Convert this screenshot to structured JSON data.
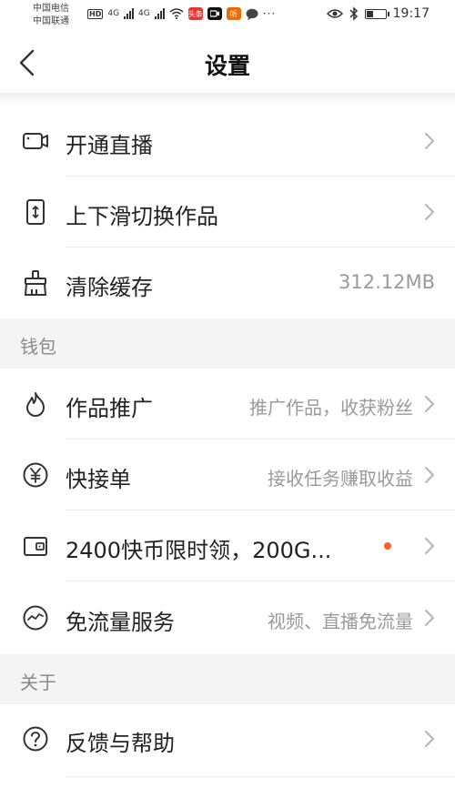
{
  "status_bar": {
    "carrier_1": "中国电信",
    "carrier_2": "中国联通",
    "hd": "HD",
    "net_1": "4G",
    "net_2": "4G",
    "app_icon_1": "头条",
    "app_icon_2": "听",
    "time": "19:17",
    "battery_level": 0.35
  },
  "navbar": {
    "title": "设置"
  },
  "items": {
    "live": {
      "label": "开通直播",
      "icon": "video-camera-icon"
    },
    "swipe": {
      "label": "上下滑切换作品",
      "icon": "vertical-swipe-icon"
    },
    "cache": {
      "label": "清除缓存",
      "value": "312.12MB",
      "icon": "broom-icon"
    },
    "promote": {
      "label": "作品推广",
      "sub": "推广作品，收获粉丝",
      "icon": "flame-icon"
    },
    "quick_order": {
      "label": "快接单",
      "sub": "接收任务赚取收益",
      "icon": "yen-coin-icon"
    },
    "coins": {
      "label": "2400快币限时领，200G...",
      "icon": "wallet-icon",
      "badge_color": "#f2622e"
    },
    "free_data": {
      "label": "免流量服务",
      "sub": "视频、直播免流量",
      "icon": "wave-circle-icon"
    },
    "feedback": {
      "label": "反馈与帮助",
      "icon": "question-circle-icon"
    }
  },
  "sections": {
    "wallet": "钱包",
    "about": "关于"
  }
}
